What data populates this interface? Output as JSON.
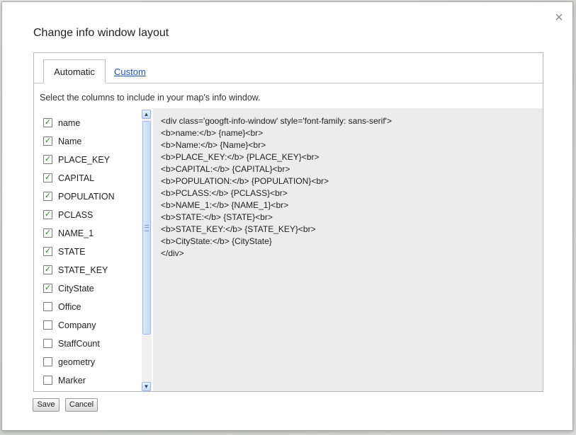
{
  "dialog": {
    "title": "Change info window layout",
    "close_glyph": "×",
    "close_icon": "close-icon"
  },
  "tabs": {
    "automatic": "Automatic",
    "custom": "Custom",
    "active": "automatic"
  },
  "instructions": "Select the columns to include in your map's info window.",
  "columns": [
    {
      "label": "name",
      "checked": true
    },
    {
      "label": "Name",
      "checked": true
    },
    {
      "label": "PLACE_KEY",
      "checked": true
    },
    {
      "label": "CAPITAL",
      "checked": true
    },
    {
      "label": "POPULATION",
      "checked": true
    },
    {
      "label": "PCLASS",
      "checked": true
    },
    {
      "label": "NAME_1",
      "checked": true
    },
    {
      "label": "STATE",
      "checked": true
    },
    {
      "label": "STATE_KEY",
      "checked": true
    },
    {
      "label": "CityState",
      "checked": true
    },
    {
      "label": "Office",
      "checked": false
    },
    {
      "label": "Company",
      "checked": false
    },
    {
      "label": "StaffCount",
      "checked": false
    },
    {
      "label": "geometry",
      "checked": false
    },
    {
      "label": "Marker",
      "checked": false
    }
  ],
  "scrollbar": {
    "up_glyph": "▲",
    "down_glyph": "▼"
  },
  "template_code": [
    "<div class='googft-info-window' style='font-family: sans-serif'>",
    "<b>name:</b> {name}<br>",
    "<b>Name:</b> {Name}<br>",
    "<b>PLACE_KEY:</b> {PLACE_KEY}<br>",
    "<b>CAPITAL:</b> {CAPITAL}<br>",
    "<b>POPULATION:</b> {POPULATION}<br>",
    "<b>PCLASS:</b> {PCLASS}<br>",
    "<b>NAME_1:</b> {NAME_1}<br>",
    "<b>STATE:</b> {STATE}<br>",
    "<b>STATE_KEY:</b> {STATE_KEY}<br>",
    "<b>CityState:</b> {CityState}",
    "</div>"
  ],
  "buttons": {
    "save": "Save",
    "cancel": "Cancel"
  },
  "colors": {
    "link": "#2255aa",
    "check": "#2c7a2c",
    "code_bg": "#ececec"
  }
}
